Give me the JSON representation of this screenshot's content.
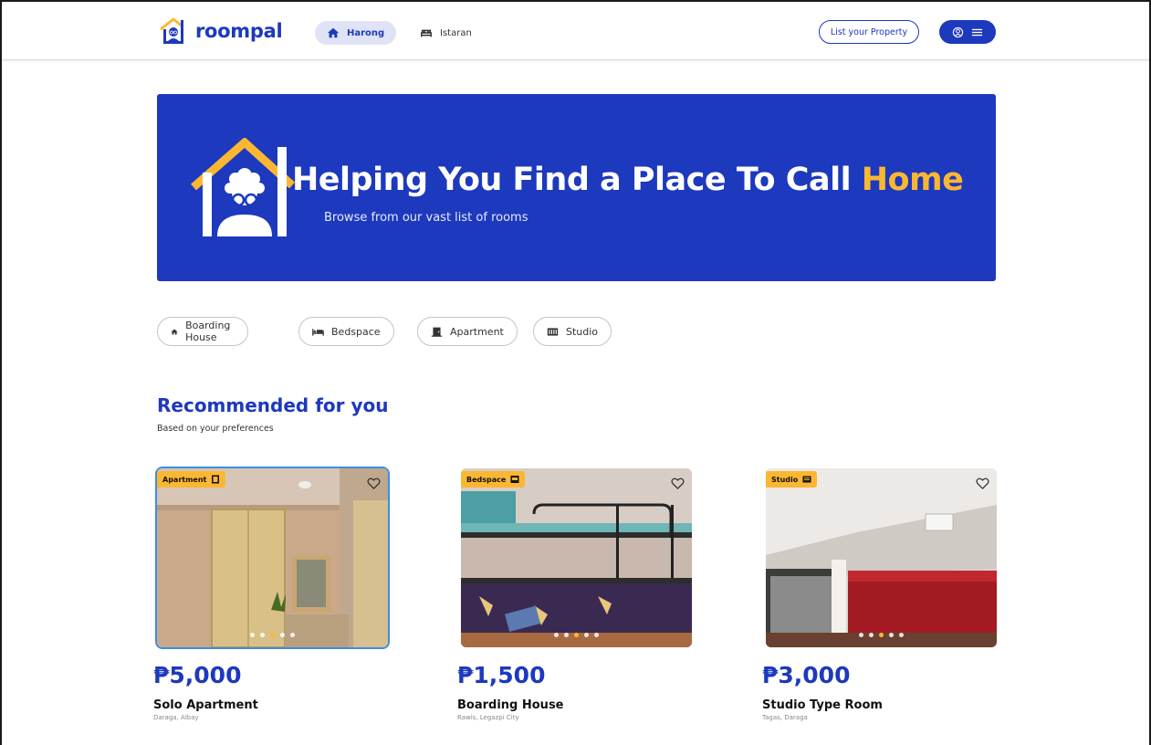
{
  "header": {
    "brand": "roompal",
    "tabs": [
      {
        "label": "Harong",
        "icon": "home-icon",
        "active": true
      },
      {
        "label": "Istaran",
        "icon": "bed-icon",
        "active": false
      }
    ],
    "list_property_label": "List  your Property",
    "user_menu_icons": [
      "user-circle-icon",
      "menu-icon"
    ]
  },
  "hero": {
    "title_prefix": "Helping You Find a Place To Call ",
    "title_accent": "Home",
    "subtitle": "Browse from our vast list of rooms"
  },
  "filters": [
    {
      "label": "Boarding House",
      "icon": "home-icon"
    },
    {
      "label": "Bedspace",
      "icon": "bed-icon"
    },
    {
      "label": "Apartment",
      "icon": "door-icon"
    },
    {
      "label": "Studio",
      "icon": "studio-icon"
    }
  ],
  "recommended": {
    "title": "Recommended for you",
    "subtitle": "Based on your preferences",
    "cards": [
      {
        "badge": "Apartment",
        "badge_icon": "door-icon",
        "price": "₱5,000",
        "title": "Solo Apartment",
        "location": "Daraga, Albay",
        "active_dot": 3,
        "dot_count": 5
      },
      {
        "badge": "Bedspace",
        "badge_icon": "bed-icon",
        "price": "₱1,500",
        "title": "Boarding House",
        "location": "Rawis, Legazpi City",
        "active_dot": 3,
        "dot_count": 5
      },
      {
        "badge": "Studio",
        "badge_icon": "studio-icon",
        "price": "₱3,000",
        "title": "Studio Type Room",
        "location": "Tagas, Daraga",
        "active_dot": 3,
        "dot_count": 5
      }
    ]
  },
  "colors": {
    "primary": "#1d39bd",
    "accent": "#fbb731",
    "tab_active_bg": "#dfe3f5"
  }
}
